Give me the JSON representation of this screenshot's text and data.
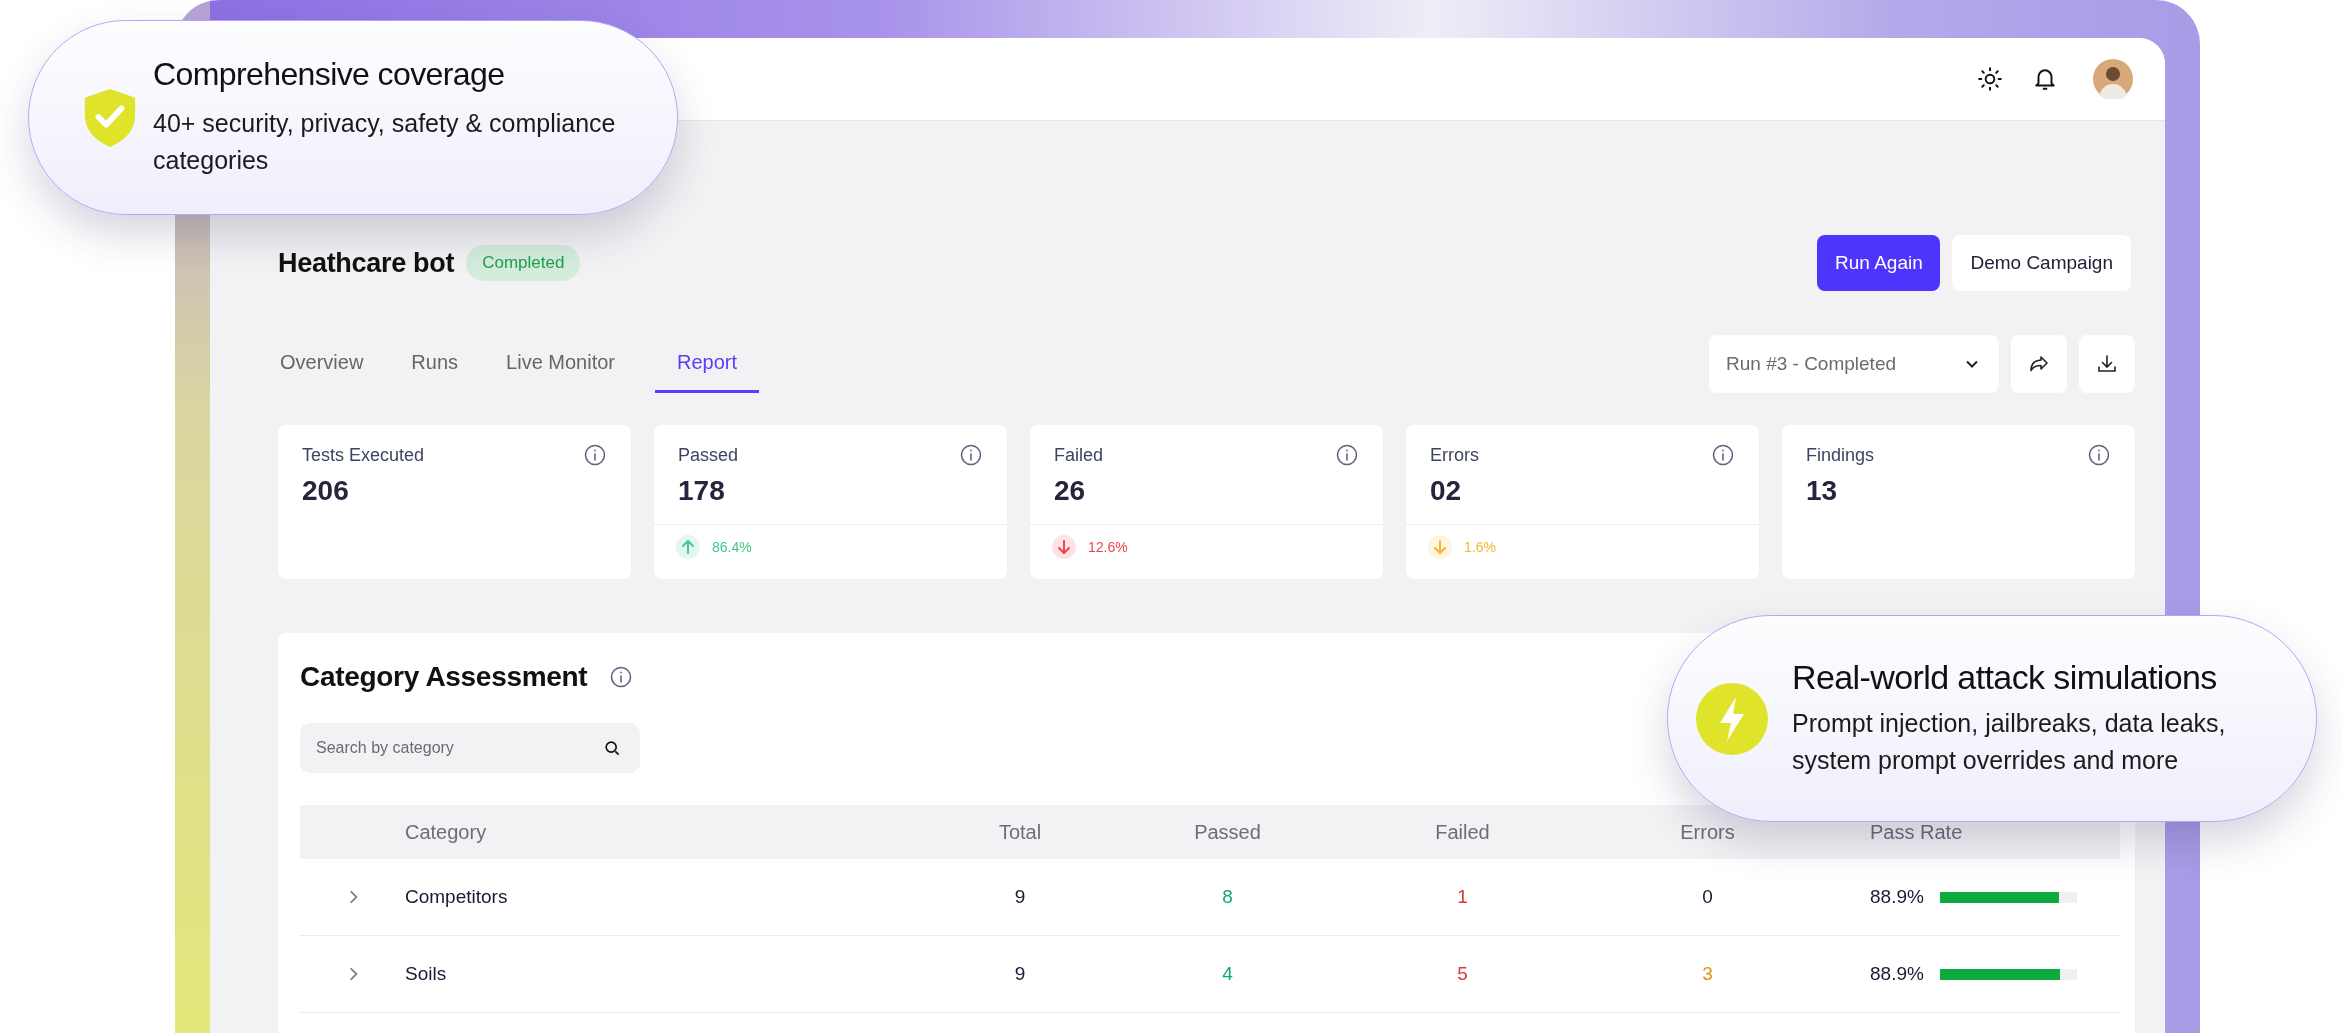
{
  "callouts": [
    {
      "kind": "coverage",
      "title": "Comprehensive coverage",
      "text": "40+ security, privacy, safety & compliance categories"
    },
    {
      "kind": "attack",
      "title": "Real-world attack simulations",
      "text": "Prompt injection, jailbreaks, data leaks, system prompt overrides and more"
    }
  ],
  "project": {
    "title": "Heathcare bot",
    "status": "Completed"
  },
  "actions": [
    {
      "label": "Run Again",
      "primary": true
    },
    {
      "label": "Demo Campaign",
      "primary": false
    }
  ],
  "tabs": [
    {
      "label": "Overview",
      "selected": false
    },
    {
      "label": "Runs",
      "selected": false
    },
    {
      "label": "Live Monitor",
      "selected": false
    },
    {
      "label": "Report",
      "selected": true
    }
  ],
  "run_select": {
    "value": "Run #3 - Completed"
  },
  "stats": [
    {
      "label": "Tests Executed",
      "value": "206"
    },
    {
      "label": "Passed",
      "value": "178",
      "trend": {
        "kind": "up",
        "value": "86.4%",
        "color": "#3fc98c"
      }
    },
    {
      "label": "Failed",
      "value": "26",
      "trend": {
        "kind": "down",
        "value": "12.6%",
        "color": "#f0444d"
      }
    },
    {
      "label": "Errors",
      "value": "02",
      "trend": {
        "kind": "down",
        "value": "1.6%",
        "color": "#f5b82e"
      }
    },
    {
      "label": "Findings",
      "value": "13"
    }
  ],
  "assessment": {
    "title": "Category Assessment",
    "search": {
      "placeholder": "Search by category"
    },
    "columns": [
      "Category",
      "Total",
      "Passed",
      "Failed",
      "Errors",
      "Pass Rate"
    ],
    "rows": [
      {
        "category": "Competitors",
        "total": "9",
        "passed": "8",
        "failed": "1",
        "errors": "0",
        "errors_flagged": false,
        "pass_rate": "88.9%",
        "level": 0.87
      },
      {
        "category": "Soils",
        "total": "9",
        "passed": "4",
        "failed": "5",
        "errors": "3",
        "errors_flagged": true,
        "pass_rate": "88.9%",
        "level": 0.88
      }
    ]
  }
}
